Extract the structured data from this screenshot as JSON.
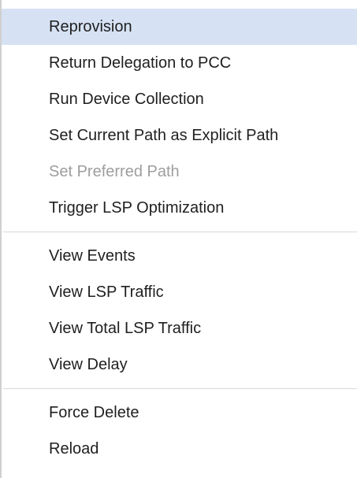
{
  "menu": {
    "groups": [
      {
        "items": [
          {
            "label": "Reprovision",
            "state": "highlighted"
          },
          {
            "label": "Return Delegation to PCC",
            "state": "enabled"
          },
          {
            "label": "Run Device Collection",
            "state": "enabled"
          },
          {
            "label": "Set Current Path as Explicit Path",
            "state": "enabled"
          },
          {
            "label": "Set Preferred Path",
            "state": "disabled"
          },
          {
            "label": "Trigger LSP Optimization",
            "state": "enabled"
          }
        ]
      },
      {
        "items": [
          {
            "label": "View Events",
            "state": "enabled"
          },
          {
            "label": "View LSP Traffic",
            "state": "enabled"
          },
          {
            "label": "View Total LSP Traffic",
            "state": "enabled"
          },
          {
            "label": "View Delay",
            "state": "enabled"
          }
        ]
      },
      {
        "items": [
          {
            "label": "Force Delete",
            "state": "enabled"
          },
          {
            "label": "Reload",
            "state": "enabled"
          }
        ]
      }
    ],
    "colors": {
      "highlight_bg": "#d6e2f4",
      "text": "#1f1f1f",
      "disabled_text": "#9e9e9e",
      "separator": "#d9d9d9"
    }
  }
}
